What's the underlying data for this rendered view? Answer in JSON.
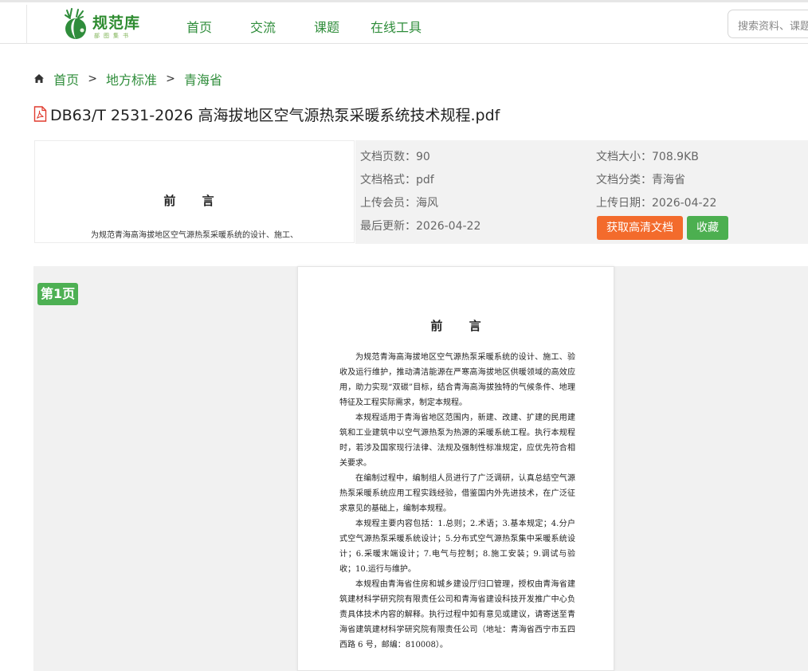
{
  "header": {
    "logo_name": "规范库",
    "logo_slogan": "部图集书",
    "nav": [
      "首页",
      "交流",
      "课题",
      "在线工具"
    ],
    "search_placeholder": "搜索资料、课题"
  },
  "breadcrumb": [
    "首页",
    "地方标准",
    "青海省"
  ],
  "document": {
    "title": "DB63/T 2531-2026 高海拔地区空气源热泵采暖系统技术规程.pdf",
    "preview_heading": "前 言",
    "preview_line": "为规范青海高海拔地区空气源热泵采暖系统的设计、施工、"
  },
  "info": {
    "pages_label": "文档页数：",
    "pages": "90",
    "size_label": "文档大小：",
    "size": "708.9KB",
    "format_label": "文档格式：",
    "format": "pdf",
    "category_label": "文档分类：",
    "category": "青海省",
    "uploader_label": "上传会员：",
    "uploader": "海风",
    "upload_date_label": "上传日期：",
    "upload_date": "2026-04-22",
    "updated_label": "最后更新：",
    "updated": "2026-04-22",
    "hd_button": "获取高清文档",
    "fav_button": "收藏"
  },
  "viewer": {
    "page_badge": "第1页",
    "heading": "前  言",
    "paragraphs": [
      "为规范青海高海拔地区空气源热泵采暖系统的设计、施工、验收及运行维护，推动清洁能源在严寒高海拔地区供暖领域的高效应用，助力实现“双碳”目标，结合青海高海拔独特的气候条件、地理特征及工程实际需求，制定本规程。",
      "本规程适用于青海省地区范围内，新建、改建、扩建的民用建筑和工业建筑中以空气源热泵为热源的采暖系统工程。执行本规程时，若涉及国家现行法律、法规及强制性标准规定，应优先符合相关要求。",
      "在编制过程中，编制组人员进行了广泛调研，认真总结空气源热泵采暖系统应用工程实践经验，借鉴国内外先进技术，在广泛征求意见的基础上，编制本规程。",
      "本规程主要内容包括：1.总则；2.术语；3.基本规定；4.分户式空气源热泵采暖系统设计；5.分布式空气源热泵集中采暖系统设计；6.采暖末端设计；7.电气与控制；8.施工安装；9.调试与验收；10.运行与维护。",
      "本规程由青海省住房和城乡建设厅归口管理，授权由青海省建筑建材科学研究院有限责任公司和青海省建设科技开发推广中心负责具体技术内容的解释。执行过程中如有意见或建议，请寄送至青海省建筑建材科学研究院有限责任公司（地址：青海省西宁市五四西路 6 号，邮编：810008）。"
    ]
  }
}
